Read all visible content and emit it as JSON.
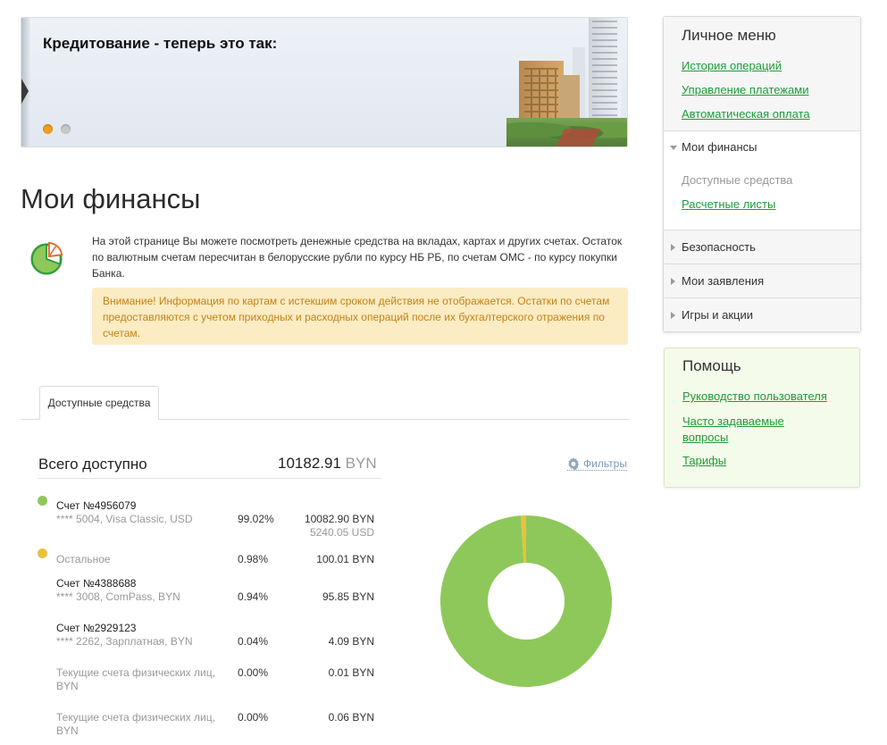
{
  "banner": {
    "title": "Кредитование - теперь это так:",
    "slides": 2,
    "active_slide": 1
  },
  "page": {
    "title": "Мои финансы",
    "intro": "На этой странице Вы можете посмотреть денежные средства на вкладах, картах и других счетах. Остаток по валютным счетам пересчитан в белорусские рубли по курсу НБ РБ, по счетам ОМС - по курсу покупки Банка.",
    "notice": "Внимание! Информация по картам с истекшим сроком действия не отображается. Остатки по счетам предоставляются с учетом приходных и расходных операций после их бухгалтерского отражения по счетам."
  },
  "tabs": [
    {
      "label": "Доступные средства",
      "active": true
    }
  ],
  "summary": {
    "total_label": "Всего доступно",
    "total_value": "10182.91",
    "total_currency": "BYN",
    "filters_label": "Фильтры"
  },
  "accounts": {
    "main": {
      "name": "Счет №4956079",
      "desc": "**** 5004, Visa Classic, USD",
      "percent": "99.02%",
      "amount": "10082.90 BYN",
      "amount_alt": "5240.05 USD",
      "color": "#8ec85a"
    },
    "other_group": {
      "name": "Остальное",
      "percent": "0.98%",
      "amount": "100.01 BYN",
      "color": "#e8c23c"
    },
    "rows": [
      {
        "name": "Счет №4388688",
        "desc": "**** 3008, ComPass, BYN",
        "percent": "0.94%",
        "amount": "95.85 BYN"
      },
      {
        "name": "Счет №2929123",
        "desc": "**** 2262, Зарплатная, BYN",
        "percent": "0.04%",
        "amount": "4.09 BYN"
      },
      {
        "name_line1": "Текущие счета физических лиц,",
        "name_line2": "BYN",
        "percent": "0.00%",
        "amount": "0.01 BYN"
      },
      {
        "name_line1": "Текущие счета физических лиц,",
        "name_line2": "BYN",
        "percent": "0.00%",
        "amount": "0.06 BYN"
      }
    ]
  },
  "chart_data": {
    "type": "pie",
    "categories": [
      "Счет №4956079",
      "Остальное"
    ],
    "values": [
      99.02,
      0.98
    ],
    "colors": [
      "#8ec85a",
      "#e8c23c"
    ],
    "title": ""
  },
  "sidebar": {
    "menu_title": "Личное меню",
    "links": [
      "История операций",
      "Управление платежами",
      "Автоматическая оплата"
    ],
    "finance_section": "Мои финансы",
    "finance_items": [
      {
        "label": "Доступные средства",
        "active": true
      },
      {
        "label": "Расчетные листы",
        "active": false
      }
    ],
    "sections": [
      "Безопасность",
      "Мои заявления",
      "Игры и акции"
    ]
  },
  "help": {
    "title": "Помощь",
    "links": [
      "Руководство пользователя",
      "Часто задаваемые вопросы",
      "Тарифы"
    ]
  }
}
